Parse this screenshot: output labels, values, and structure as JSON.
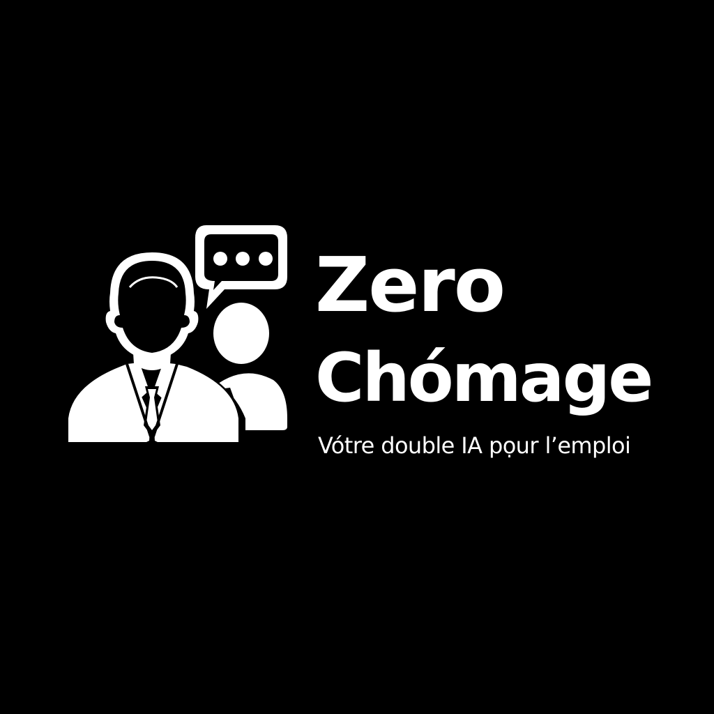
{
  "brand": {
    "name_line1": "Zero",
    "name_line2": "Chómage",
    "tagline": "Vótre double IA pọur l’emploi"
  },
  "icons": {
    "main": "businessman-icon",
    "secondary": "person-silhouette-icon",
    "bubble": "speech-bubble-icon"
  },
  "colors": {
    "background": "#000000",
    "foreground": "#ffffff"
  }
}
